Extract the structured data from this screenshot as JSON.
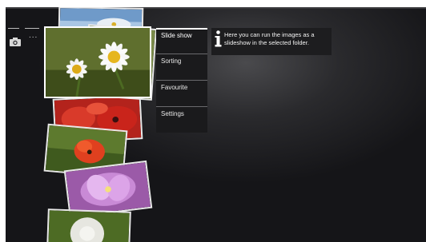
{
  "menu": {
    "items": [
      {
        "label": "Slide show",
        "selected": true
      },
      {
        "label": "Sorting",
        "selected": false
      },
      {
        "label": "Favourite",
        "selected": false
      },
      {
        "label": "Settings",
        "selected": false
      }
    ]
  },
  "info": {
    "icon": "info-icon",
    "text": "Here you can run the images as a slideshow in the selected folder."
  },
  "header": {
    "source_icon": "camera-icon",
    "ellipsis": "..."
  },
  "colors": {
    "background": "#151518",
    "menu_background": "#1a1a1c",
    "text": "#e8e8e8"
  }
}
